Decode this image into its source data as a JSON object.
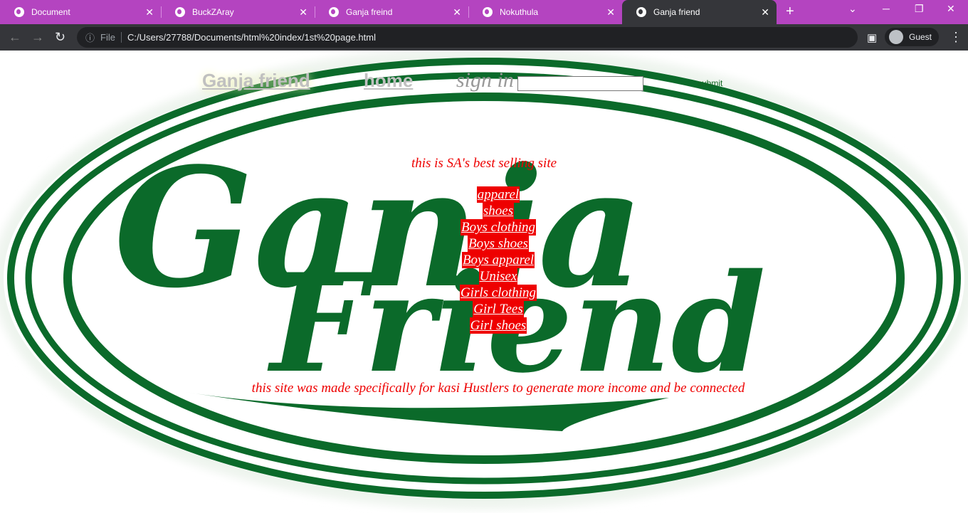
{
  "browser": {
    "tabs": [
      {
        "title": "Document"
      },
      {
        "title": "BuckZAray"
      },
      {
        "title": "Ganja freind"
      },
      {
        "title": "Nokuthula"
      },
      {
        "title": "Ganja friend",
        "active": true
      }
    ],
    "file_label": "File",
    "url": "C:/Users/27788/Documents/html%20index/1st%20page.html",
    "profile": "Guest"
  },
  "page": {
    "brand": "Ganja friend",
    "home": "home",
    "sign_in": "sign in",
    "sign_in_value": "",
    "submit": "submit",
    "tagline": "this is SA's best selling site",
    "links": [
      "apparel",
      "shoes",
      "Boys clothing",
      "Boys shoes",
      "Boys apparel",
      "Unisex",
      "Girls clothing",
      "Girl Tees",
      "Girl shoes"
    ],
    "footer": "this site was made specifically for kasi Hustlers to generate more income and be connected",
    "logo_text": "Ganja Friend",
    "colors": {
      "logo_green": "#0b6a2a",
      "link_bg": "#e00000",
      "tab_bar": "#b444c0"
    }
  }
}
